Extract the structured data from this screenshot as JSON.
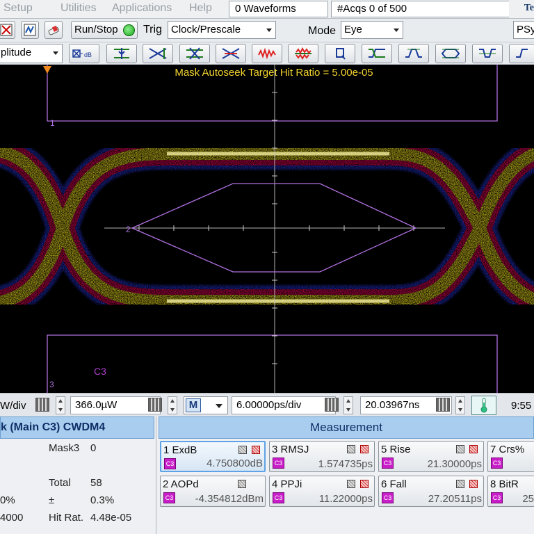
{
  "menu": {
    "items": [
      "Setup",
      "Utilities",
      "Applications",
      "Help"
    ],
    "waveforms": "0 Waveforms",
    "acqs": "#Acqs  0 of 500",
    "brand": "Te"
  },
  "toolbar": {
    "run_stop": "Run/Stop",
    "trig_label": "Trig",
    "trig_value": "Clock/Prescale",
    "mode_label": "Mode",
    "mode_value": "Eye",
    "psy_label": "PSy",
    "amplitude_value": "plitude",
    "db_label": "dB",
    "icons": [
      "cursor-x-icon",
      "db-icon",
      "pulse-mode-icon",
      "autoscale-icon",
      "mask-icon",
      "crosshair-icon",
      "noise-icon",
      "spread-icon",
      "box-icon",
      "rise-edge-icon",
      "fall-edge-icon",
      "eye-icon",
      "pulse-neg-icon",
      "step-icon"
    ]
  },
  "display": {
    "hit_ratio": "Mask Autoseek Target Hit Ratio = 5.00e-05",
    "marker1": "1",
    "marker2": "2",
    "marker3": "3",
    "channel": "C3",
    "colors": {
      "trace_outer": "#1e3cff",
      "trace_mid": "#ff0060",
      "trace_inner": "#ffee20",
      "mask": "#b070e0",
      "grid": "#c8c8c8"
    }
  },
  "statusbar": {
    "vdiv": "W/div",
    "vert_scale": "366.0µW",
    "m_button": "M",
    "time_div": "6.00000ps/div",
    "position": "20.03967ns",
    "clock": "9:55"
  },
  "mask_panel": {
    "header": "k (Main  C3) CWDM4",
    "mask3_label": "Mask3",
    "mask3_value": "0",
    "total_label": "Total",
    "total_value": "58",
    "pm_label": "±",
    "pm_value": "0.3%",
    "left_pct": "0%",
    "left_num": "4000",
    "hit_label": "Hit Rat.",
    "hit_value": "4.48e-05"
  },
  "measurement": {
    "header": "Measurement",
    "source": "C3",
    "cards": [
      {
        "name": "1 ExdB",
        "value": "4.750800dB"
      },
      {
        "name": "2 AOPd",
        "value": "-4.354812dBm"
      },
      {
        "name": "3 RMSJ",
        "value": "1.574735ps"
      },
      {
        "name": "4 PPJi",
        "value": "11.22000ps"
      },
      {
        "name": "5 Rise",
        "value": "21.30000ps"
      },
      {
        "name": "6 Fall",
        "value": "27.20511ps"
      },
      {
        "name": "7 Crs%",
        "value": ""
      },
      {
        "name": "8 BitR",
        "value": "25"
      }
    ]
  }
}
